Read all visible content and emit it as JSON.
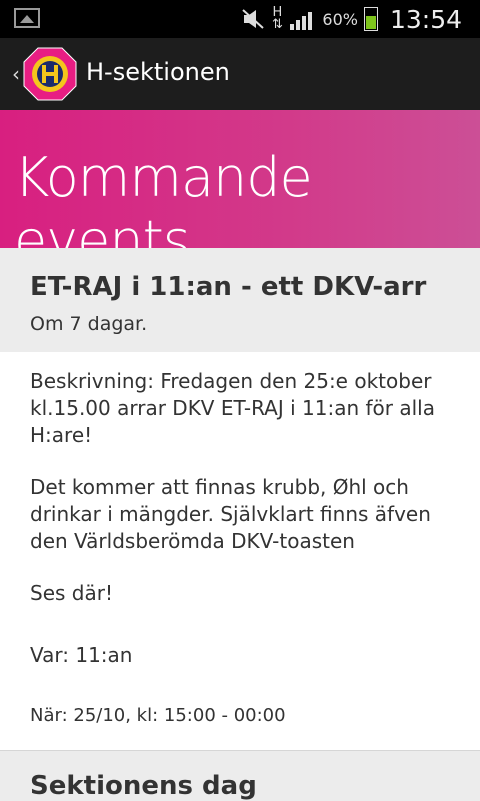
{
  "status_bar": {
    "battery_percent": "60%",
    "time": "13:54",
    "network_type": "H",
    "icons": [
      "image-notification-icon",
      "mute-icon",
      "network-h-icon",
      "signal-icon",
      "battery-icon"
    ],
    "battery_color": "#7ec41c",
    "battery_level": 0.6
  },
  "action_bar": {
    "title": "H-sektionen",
    "logo": "h-sektionen-logo"
  },
  "banner": {
    "title": "Kommande events",
    "color": "#d81f80"
  },
  "events": [
    {
      "title": "ET-RAJ i 11:an - ett DKV-arr",
      "relative_time": "Om 7 dagar.",
      "description_1": "Beskrivning: Fredagen den 25:e oktober kl.15.00 arrar DKV ET-RAJ i 11:an för alla H:are!",
      "description_2": "Det kommer att finnas krubb, Øhl och drinkar i mängder. Självklart finns äfven den Världsberömda DKV-toasten",
      "description_3": "Ses där!",
      "location": "Var: 11:an",
      "time": "När: 25/10, kl: 15:00 - 00:00"
    },
    {
      "title": "Sektionens dag"
    }
  ]
}
